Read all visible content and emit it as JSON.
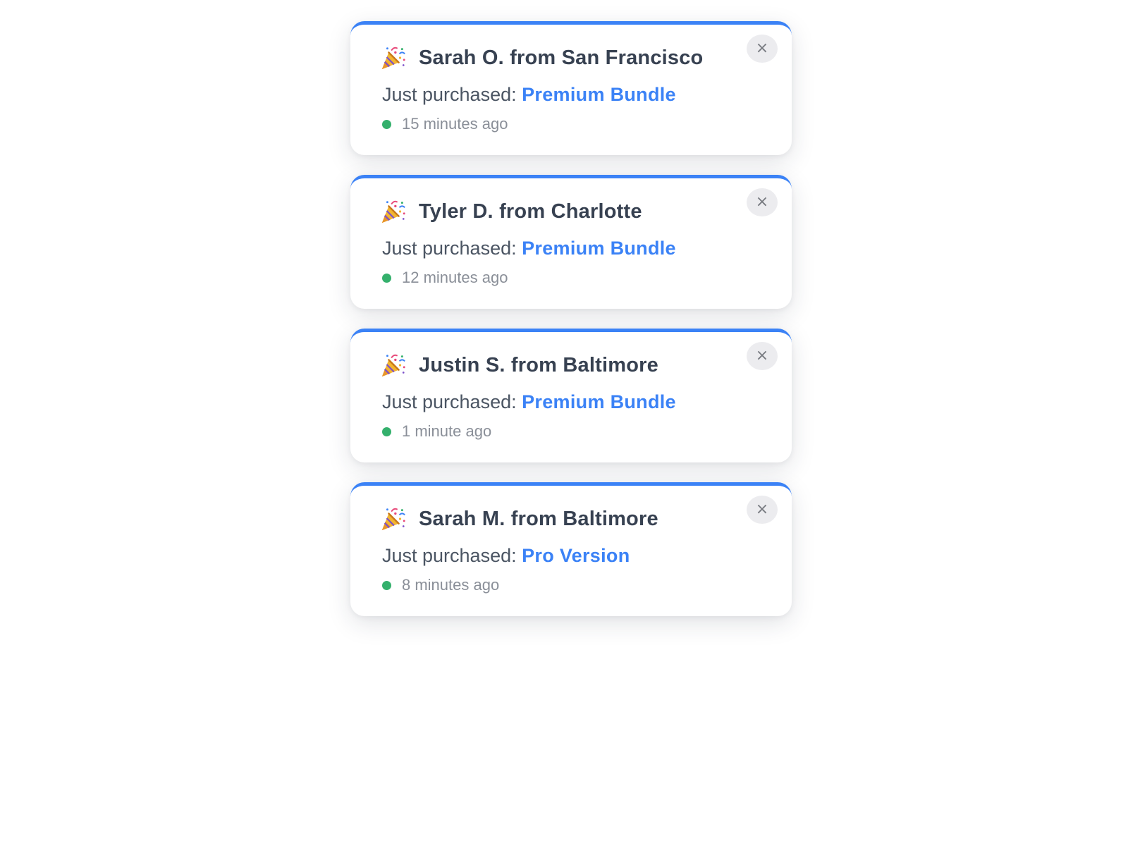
{
  "notifications": [
    {
      "name": "Sarah O. from San Francisco",
      "purchase_label": "Just purchased:",
      "product": "Premium Bundle",
      "time_ago": "15 minutes ago",
      "icon": "party-popper-icon",
      "close_label": "×"
    },
    {
      "name": "Tyler D. from Charlotte",
      "purchase_label": "Just purchased:",
      "product": "Premium Bundle",
      "time_ago": "12 minutes ago",
      "icon": "party-popper-icon",
      "close_label": "×"
    },
    {
      "name": "Justin S. from Baltimore",
      "purchase_label": "Just purchased:",
      "product": "Premium Bundle",
      "time_ago": "1 minute ago",
      "icon": "party-popper-icon",
      "close_label": "×"
    },
    {
      "name": "Sarah M. from Baltimore",
      "purchase_label": "Just purchased:",
      "product": "Pro Version",
      "time_ago": "8 minutes ago",
      "icon": "party-popper-icon",
      "close_label": "×"
    }
  ],
  "colors": {
    "accent": "#3b82f6",
    "status_dot": "#34b06c",
    "title_text": "#374151",
    "muted_text": "#8a8f98"
  }
}
